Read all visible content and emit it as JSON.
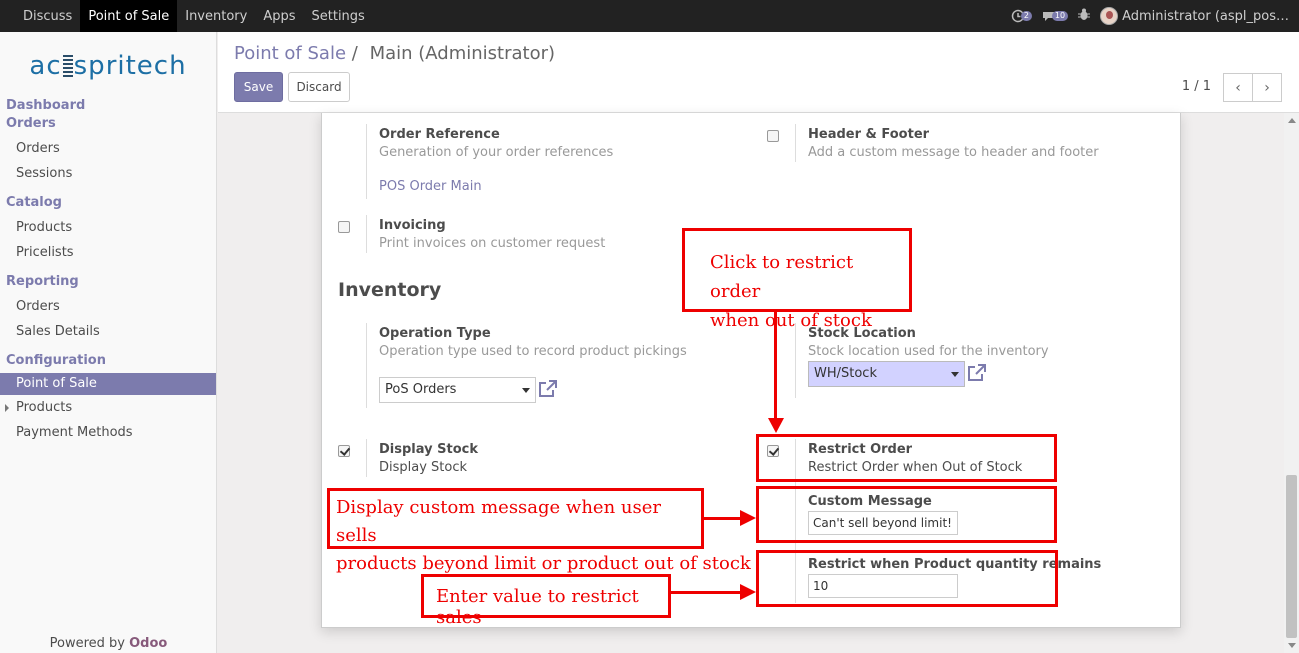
{
  "topbar": {
    "menu": [
      "Discuss",
      "Point of Sale",
      "Inventory",
      "Apps",
      "Settings"
    ],
    "activities_count": "2",
    "messages_count": "10",
    "user": "Administrator (aspl_pos…"
  },
  "sidebar": {
    "logo_text": "ac spritech",
    "sections": {
      "dashboard": "Dashboard",
      "orders": "Orders",
      "catalog": "Catalog",
      "reporting": "Reporting",
      "configuration": "Configuration"
    },
    "items": {
      "orders": "Orders",
      "sessions": "Sessions",
      "products": "Products",
      "pricelists": "Pricelists",
      "rep_orders": "Orders",
      "sales_details": "Sales Details",
      "point_of_sale": "Point of Sale",
      "conf_products": "Products",
      "payment_methods": "Payment Methods"
    },
    "powered_by": "Powered by",
    "powered_brand": "Odoo"
  },
  "control": {
    "breadcrumb_parent": "Point of Sale",
    "breadcrumb_sep": "/",
    "breadcrumb_current": "Main (Administrator)",
    "save": "Save",
    "discard": "Discard",
    "pager": "1 / 1"
  },
  "settings": {
    "order_reference": {
      "label": "Order Reference",
      "help": "Generation of your order references",
      "link": "POS Order Main"
    },
    "header_footer": {
      "label": "Header & Footer",
      "help": "Add a custom message to header and footer",
      "checked": false
    },
    "invoicing": {
      "label": "Invoicing",
      "help": "Print invoices on customer request",
      "checked": false
    },
    "inventory_title": "Inventory",
    "operation_type": {
      "label": "Operation Type",
      "help": "Operation type used to record product pickings",
      "value": "PoS Orders"
    },
    "stock_location": {
      "label": "Stock Location",
      "help": "Stock location used for the inventory",
      "value": "WH/Stock"
    },
    "display_stock": {
      "label": "Display Stock",
      "help": "Display Stock",
      "checked": true
    },
    "restrict_order": {
      "label": "Restrict Order",
      "help": "Restrict Order when Out of Stock",
      "checked": true
    },
    "custom_message": {
      "label": "Custom Message",
      "value": "Can't sell beyond limit!"
    },
    "restrict_qty": {
      "label": "Restrict when Product quantity remains",
      "value": "10"
    }
  },
  "annotations": {
    "click_restrict_1": "Click to restrict order",
    "click_restrict_2": "when out of stock",
    "custom_msg_1": "Display custom message when user sells",
    "custom_msg_2": "products beyond limit or product out of stock",
    "enter_value": "Enter value to restrict sales"
  },
  "colors": {
    "accent": "#7c7bad",
    "annotation": "#ee0000",
    "topbar": "#222222"
  }
}
